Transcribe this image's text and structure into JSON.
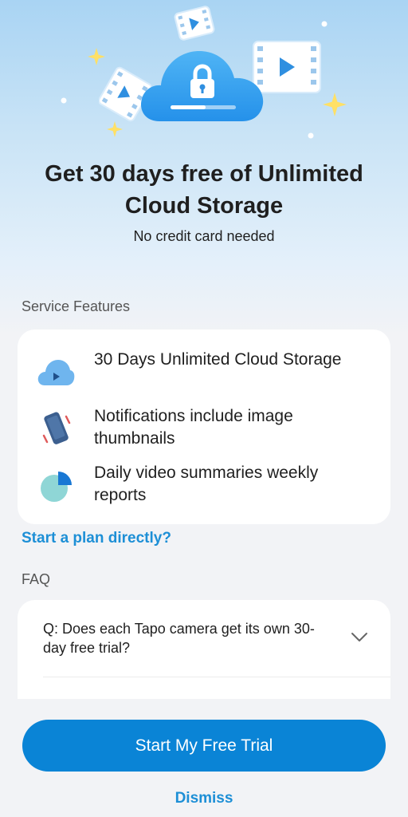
{
  "header": {
    "title": "Get 30 days free of Unlimited Cloud Storage",
    "subtitle": "No credit card needed"
  },
  "features": {
    "section_label": "Service Features",
    "items": [
      {
        "label": "30 Days Unlimited Cloud Storage",
        "icon": "cloud-play-icon"
      },
      {
        "label": "Notifications include image thumbnails",
        "icon": "phone-vibrate-icon"
      },
      {
        "label": "Daily video summaries weekly reports",
        "icon": "pie-chart-icon"
      }
    ]
  },
  "plan_link": "Start a plan directly?",
  "faq": {
    "section_label": "FAQ",
    "items": [
      {
        "question": "Q: Does each Tapo camera get its own 30-day free trial?",
        "icon": "chevron-down-icon"
      }
    ]
  },
  "actions": {
    "primary_label": "Start My Free Trial",
    "dismiss_label": "Dismiss"
  },
  "colors": {
    "accent": "#0a84d6",
    "link": "#1d8fd6",
    "cloud": "#3aa0ef"
  }
}
